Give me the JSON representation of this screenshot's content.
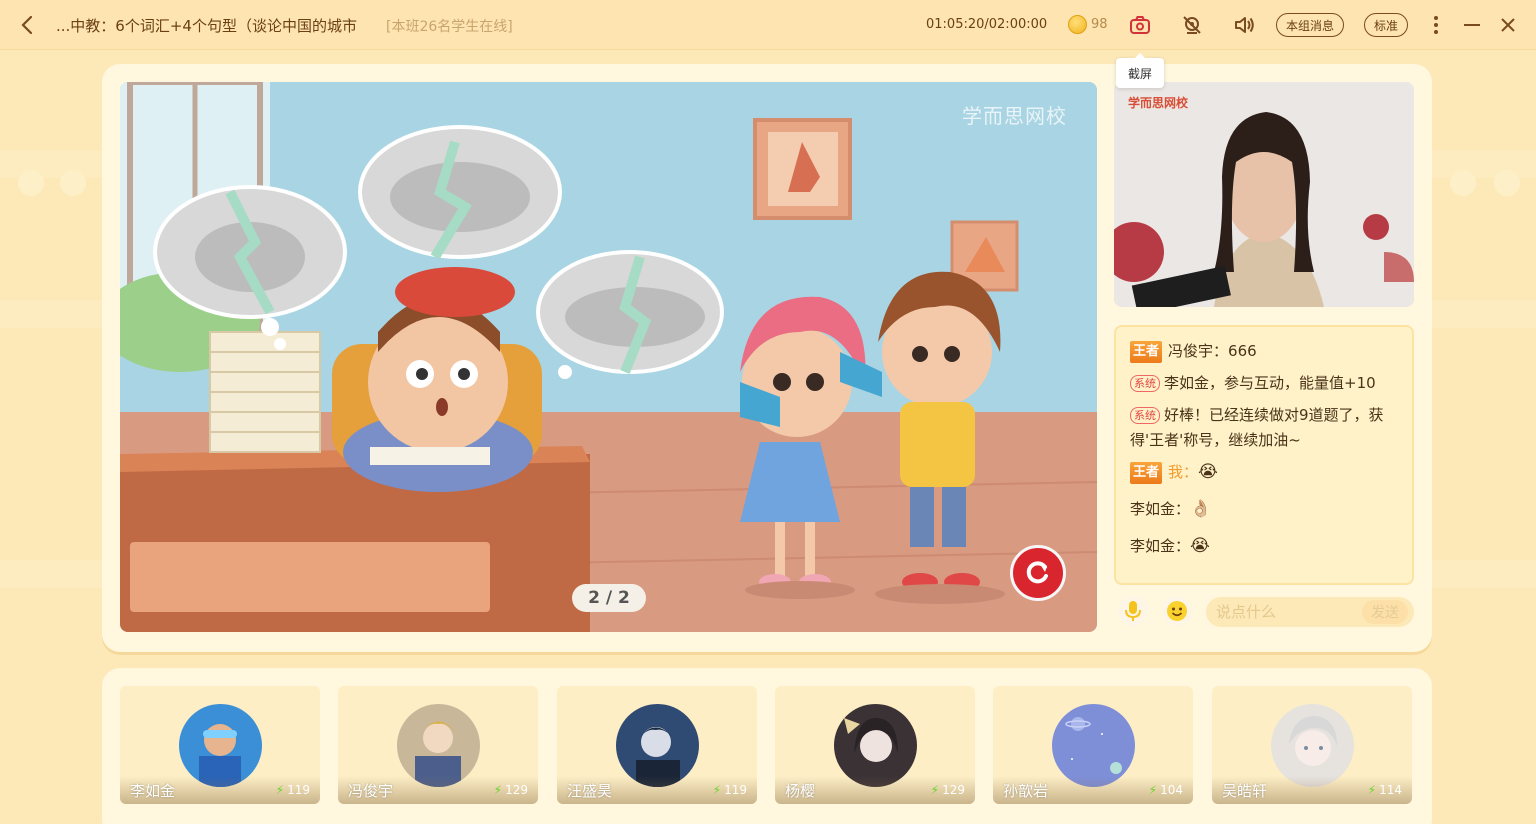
{
  "header": {
    "title": "...中教：6个词汇+4个句型（谈论中国的城市",
    "online": "[本班26名学生在线]",
    "timer": "01:05:20/02:00:00",
    "coins": "98",
    "group_msg_label": "本组消息",
    "quality_label": "标准",
    "tooltip": "截屏",
    "icons": [
      "back-arrow-icon",
      "coin-icon",
      "camera-icon",
      "camera-off-icon",
      "speaker-icon",
      "more-icon",
      "minimize-icon",
      "close-icon"
    ]
  },
  "slide": {
    "watermark": "学而思网校",
    "page": "2 / 2"
  },
  "video": {
    "logo": "学而思网校"
  },
  "chat": {
    "messages": [
      {
        "badge": "王者",
        "name": "冯俊宇",
        "sep": "：",
        "text": "666"
      },
      {
        "badge": "系统",
        "text": "李如金，参与互动，能量值+10"
      },
      {
        "badge": "系统",
        "text": "好棒！已经连续做对9道题了，获得'王者'称号，继续加油~"
      },
      {
        "badge": "王者",
        "name": "我",
        "sep": "：",
        "emoji": "😭"
      },
      {
        "name": "李如金",
        "sep": "：",
        "emoji": "👌🏼"
      },
      {
        "name": "李如金",
        "sep": "：",
        "emoji": "😭"
      }
    ],
    "input_placeholder": "说点什么",
    "send_label": "发送"
  },
  "students": [
    {
      "name": "李如金",
      "energy": "119",
      "avatar_color": "#3a8fd6"
    },
    {
      "name": "冯俊宇",
      "energy": "129",
      "avatar_color": "#c9b79a"
    },
    {
      "name": "汪盛昊",
      "energy": "119",
      "avatar_color": "#2f4b73"
    },
    {
      "name": "杨樱",
      "energy": "129",
      "avatar_color": "#3b3236"
    },
    {
      "name": "孙歆岩",
      "energy": "104",
      "avatar_color": "#7e8fd8"
    },
    {
      "name": "吴皓轩",
      "energy": "114",
      "avatar_color": "#e6e2de"
    }
  ],
  "colors": {
    "background": "#fde9b8",
    "panel": "#fff7de",
    "accent_orange": "#f39a2c",
    "badge_red": "#e04848",
    "replay_red": "#d9262e"
  }
}
